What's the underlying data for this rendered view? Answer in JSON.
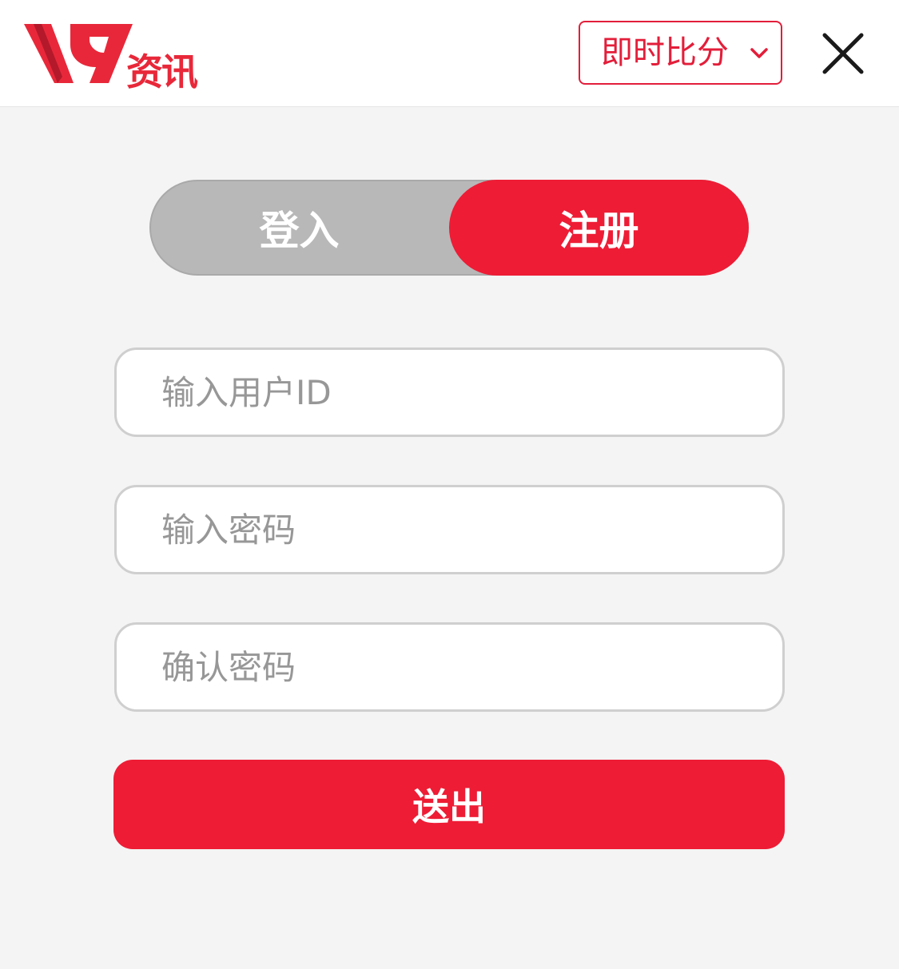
{
  "header": {
    "logo_text": "资讯",
    "score_select": {
      "selected": "即时比分",
      "icon": "chevron-down-icon"
    },
    "close_icon": "close-icon"
  },
  "tabs": [
    {
      "label": "登入",
      "active": false
    },
    {
      "label": "注册",
      "active": true
    }
  ],
  "form": {
    "userid_placeholder": "输入用户ID",
    "password_placeholder": "输入密码",
    "confirm_placeholder": "确认密码",
    "submit_label": "送出"
  },
  "colors": {
    "accent": "#ee1c35",
    "tab_inactive": "#b8b8b8",
    "page_background": "#f4f4f4"
  }
}
